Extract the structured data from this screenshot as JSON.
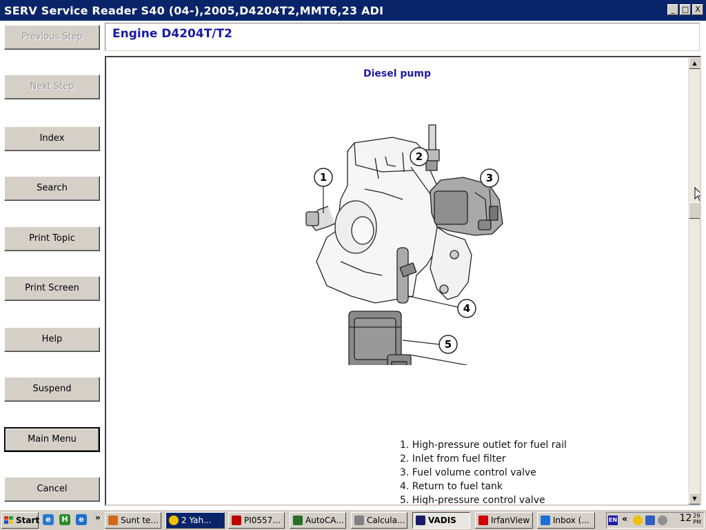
{
  "window": {
    "title": "SERV Service Reader S40 (04-),2005,D4204T2,MMT6,23 ADI",
    "minimize": "_",
    "maximize": "□",
    "close": "X"
  },
  "nav": {
    "previous_step": "Previous Step",
    "next_step": "Next Step",
    "index": "Index",
    "search": "Search",
    "print_topic": "Print Topic",
    "print_screen": "Print Screen",
    "help": "Help",
    "suspend": "Suspend",
    "main_menu": "Main Menu",
    "cancel": "Cancel"
  },
  "header": {
    "title": "Engine D4204T/T2"
  },
  "figure": {
    "title": "Diesel pump",
    "callouts": [
      "1",
      "2",
      "3",
      "4",
      "5"
    ],
    "legend": [
      "1. High-pressure outlet for fuel rail",
      "2. Inlet from fuel filter",
      "3. Fuel volume control valve",
      "4. Return to fuel tank",
      "5. High-pressure control valve"
    ]
  },
  "taskbar": {
    "start": "Start",
    "quick_more": "»",
    "tasks": [
      {
        "label": "Sunt te...",
        "icon": "firefox-icon",
        "color": "#d2691e"
      },
      {
        "label": "2 Yah...",
        "icon": "yahoo-messenger-icon",
        "color": "#f0c000"
      },
      {
        "label": "PI0557...",
        "icon": "pdf-icon",
        "color": "#c00000"
      },
      {
        "label": "AutoCA...",
        "icon": "autocad-icon",
        "color": "#2a6e2a"
      },
      {
        "label": "Calcula...",
        "icon": "calculator-icon",
        "color": "#808080"
      },
      {
        "label": "VADIS",
        "icon": "vadis-icon",
        "color": "#1a1a6a"
      },
      {
        "label": "IrfanView",
        "icon": "irfanview-icon",
        "color": "#d00000"
      },
      {
        "label": "Inbox (...",
        "icon": "ie-icon",
        "color": "#1e6fd0"
      }
    ],
    "tray": {
      "language": "EN",
      "chevron": "«",
      "time": "12",
      "ampm_top": "29",
      "ampm_bottom": "PM"
    }
  }
}
